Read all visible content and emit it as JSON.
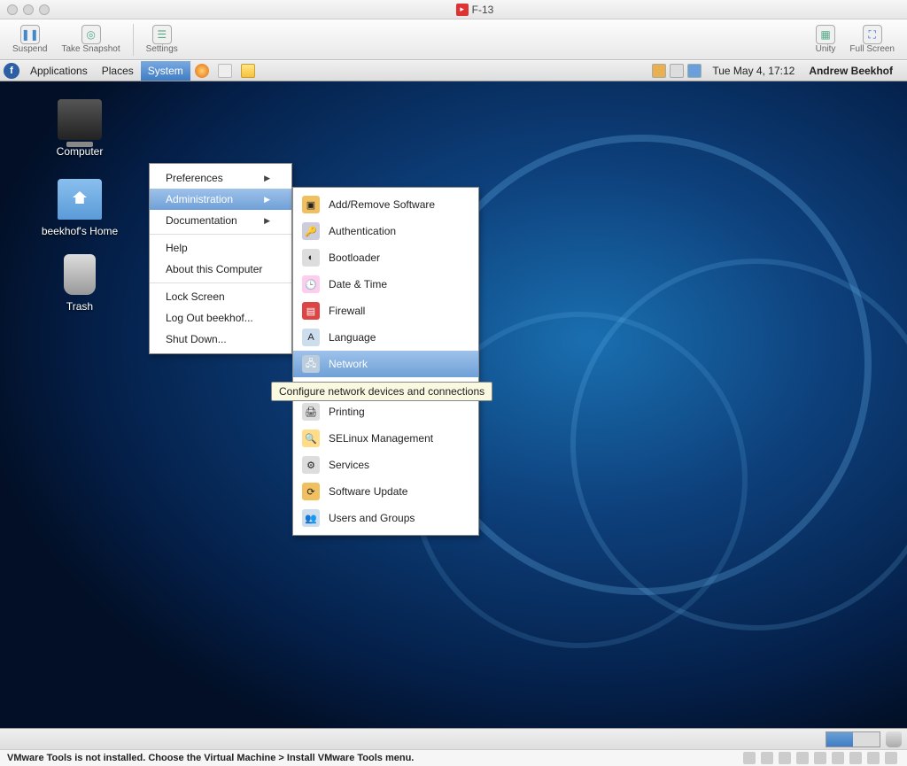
{
  "window_title": "F-13",
  "vmware_toolbar": {
    "suspend": "Suspend",
    "snapshot": "Take Snapshot",
    "settings": "Settings",
    "unity": "Unity",
    "fullscreen": "Full Screen"
  },
  "gnome_panel": {
    "applications": "Applications",
    "places": "Places",
    "system": "System",
    "clock": "Tue May  4, 17:12",
    "user": "Andrew Beekhof"
  },
  "desktop_icons": {
    "computer": "Computer",
    "home": "beekhof's Home",
    "trash": "Trash"
  },
  "system_menu": {
    "preferences": "Preferences",
    "administration": "Administration",
    "documentation": "Documentation",
    "help": "Help",
    "about": "About this Computer",
    "lock": "Lock Screen",
    "logout": "Log Out beekhof...",
    "shutdown": "Shut Down..."
  },
  "admin_menu": {
    "addremove": "Add/Remove Software",
    "auth": "Authentication",
    "bootloader": "Bootloader",
    "datetime": "Date & Time",
    "firewall": "Firewall",
    "language": "Language",
    "network": "Network",
    "printing": "Printing",
    "selinux": "SELinux Management",
    "services": "Services",
    "update": "Software Update",
    "users": "Users and Groups"
  },
  "tooltip": "Configure network devices and connections",
  "status_bar": "VMware Tools is not installed. Choose the Virtual Machine > Install VMware Tools menu."
}
